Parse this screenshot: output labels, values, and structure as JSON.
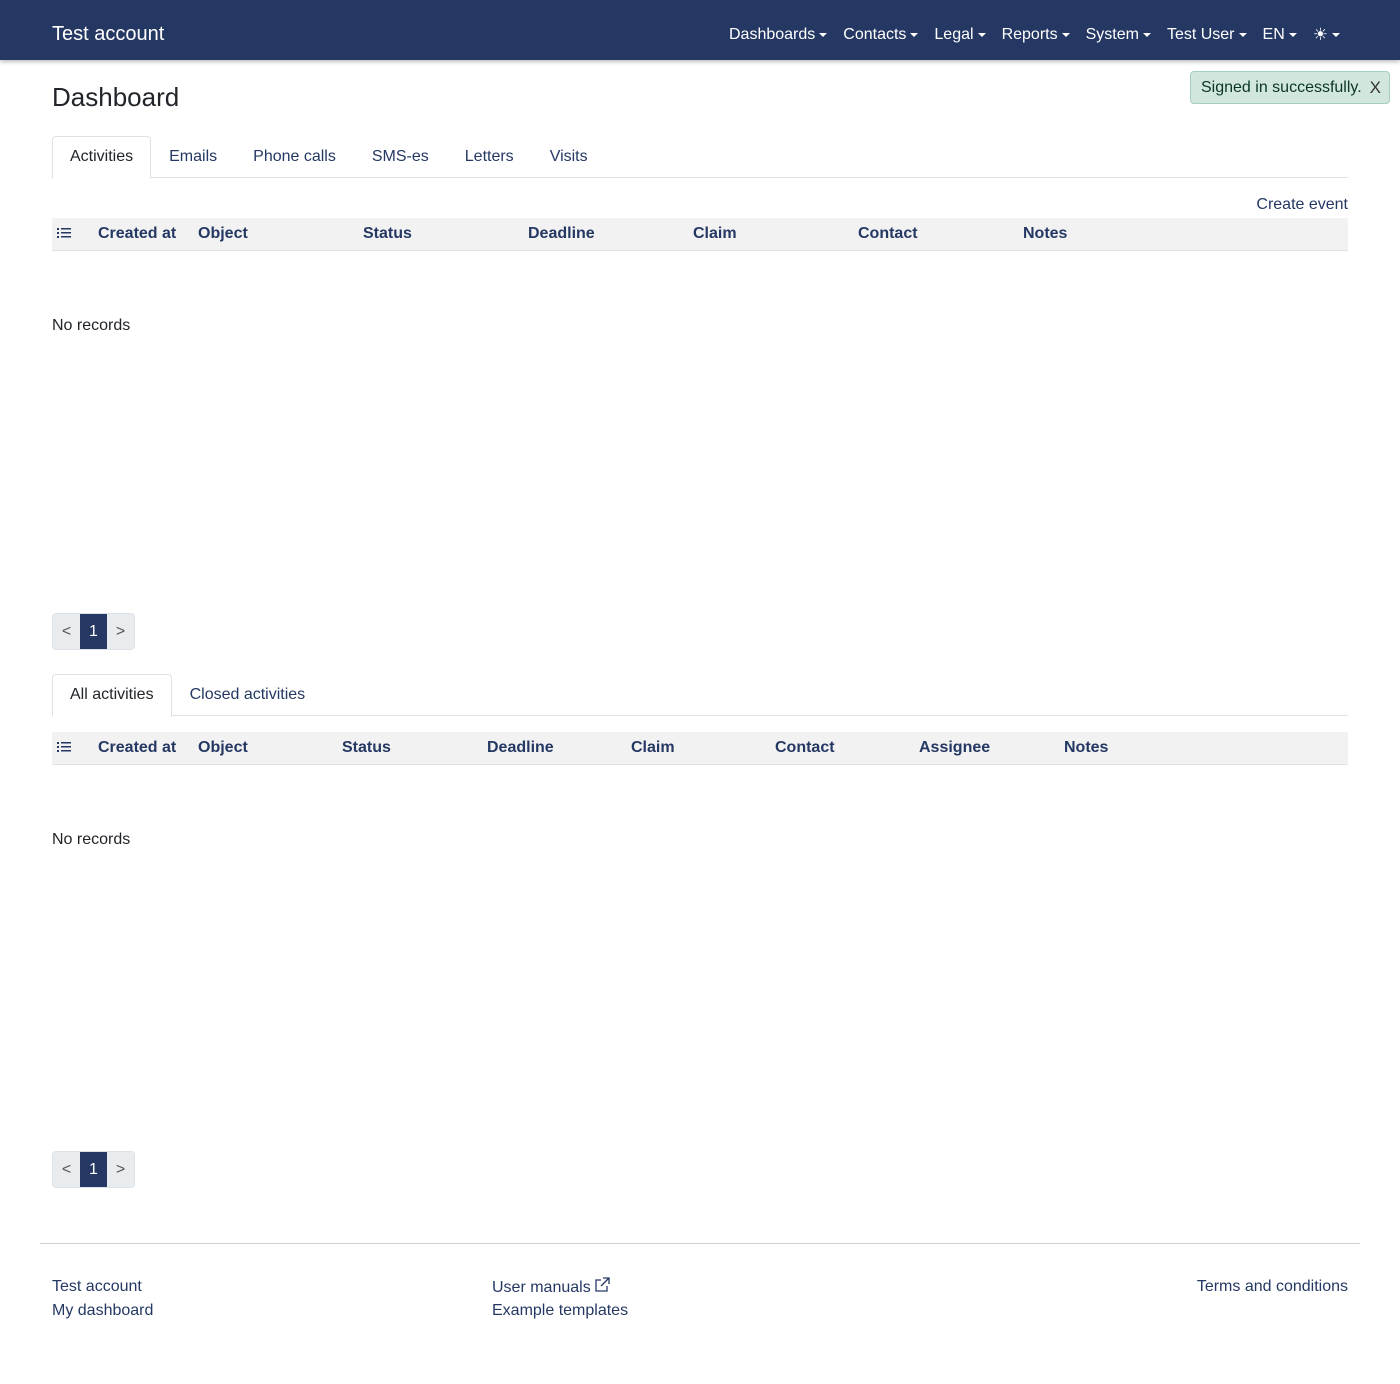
{
  "navbar": {
    "brand": "Test account",
    "menu": [
      {
        "label": "Dashboards"
      },
      {
        "label": "Contacts"
      },
      {
        "label": "Legal"
      },
      {
        "label": "Reports"
      },
      {
        "label": "System"
      },
      {
        "label": "Test User"
      },
      {
        "label": "EN"
      }
    ],
    "theme_icon": "sun-icon"
  },
  "toast": {
    "message": "Signed in successfully.",
    "close_label": "X"
  },
  "page": {
    "title": "Dashboard"
  },
  "section1": {
    "tabs": [
      "Activities",
      "Emails",
      "Phone calls",
      "SMS-es",
      "Letters",
      "Visits"
    ],
    "active_tab": "Activities",
    "create_event_label": "Create event",
    "columns": [
      "Created at",
      "Object",
      "Status",
      "Deadline",
      "Claim",
      "Contact",
      "Notes"
    ],
    "empty_text": "No records",
    "pagination": {
      "prev": "<",
      "page": "1",
      "next": ">"
    }
  },
  "section2": {
    "tabs": [
      "All activities",
      "Closed activities"
    ],
    "active_tab": "All activities",
    "columns": [
      "Created at",
      "Object",
      "Status",
      "Deadline",
      "Claim",
      "Contact",
      "Assignee",
      "Notes"
    ],
    "empty_text": "No records",
    "pagination": {
      "prev": "<",
      "page": "1",
      "next": ">"
    }
  },
  "footer": {
    "left": [
      "Test account",
      "My dashboard"
    ],
    "middle": [
      "User manuals",
      "Example templates"
    ],
    "right": [
      "Terms and conditions"
    ]
  },
  "colors": {
    "brand": "#253863",
    "toast_bg": "#d1e7dd",
    "header_bg": "#f2f2f2"
  }
}
